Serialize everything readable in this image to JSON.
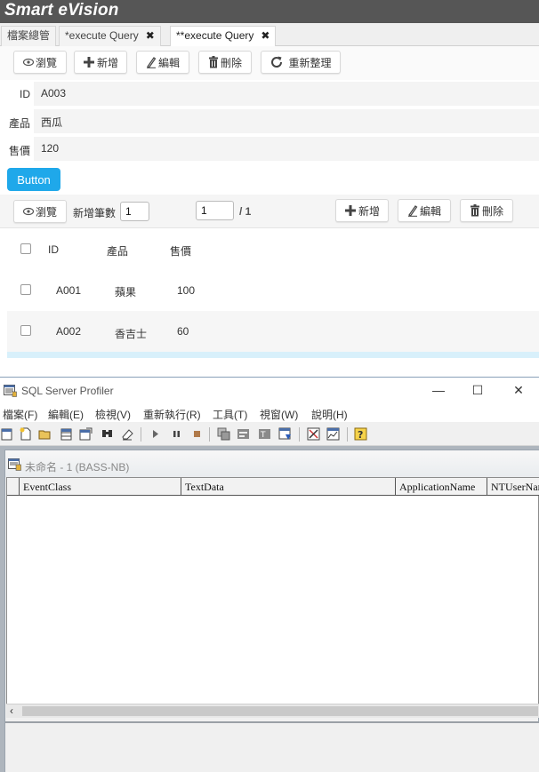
{
  "app": {
    "brand": "Smart eVision"
  },
  "tabs": [
    {
      "label": "檔案總管"
    },
    {
      "label": "*execute Query"
    },
    {
      "label": "**execute Query"
    }
  ],
  "toolbar": {
    "browse": "瀏覽",
    "add": "新增",
    "edit": "編輯",
    "delete": "刪除",
    "refresh": "重新整理"
  },
  "form": {
    "fields": [
      {
        "label": "ID",
        "value": "A003"
      },
      {
        "label": "產品",
        "value": "西瓜"
      },
      {
        "label": "售價",
        "value": "120"
      }
    ],
    "button": "Button"
  },
  "grid_toolbar": {
    "browse": "瀏覽",
    "add_count_label": "新增筆數",
    "add_count_value": "1",
    "page_value": "1",
    "page_total": "/ 1",
    "add": "新增",
    "edit": "編輯",
    "delete": "刪除"
  },
  "grid": {
    "columns": [
      "ID",
      "產品",
      "售價"
    ],
    "rows": [
      {
        "id": "A001",
        "product": "蘋果",
        "price": "100"
      },
      {
        "id": "A002",
        "product": "香吉士",
        "price": "60"
      }
    ]
  },
  "profiler": {
    "title": "SQL Server Profiler",
    "menus": [
      "檔案(F)",
      "編輯(E)",
      "檢視(V)",
      "重新執行(R)",
      "工具(T)",
      "視窗(W)",
      "說明(H)"
    ],
    "child_title": "未命名 - 1 (BASS-NB)",
    "columns": [
      "EventClass",
      "TextData",
      "ApplicationName",
      "NTUserName"
    ],
    "window_controls": {
      "minimize": "—",
      "maximize": "☐",
      "close": "✕"
    }
  },
  "colors": {
    "brand_bar": "#565656",
    "accent_button": "#1fa8ea",
    "selected_row": "#d8f0fb"
  }
}
